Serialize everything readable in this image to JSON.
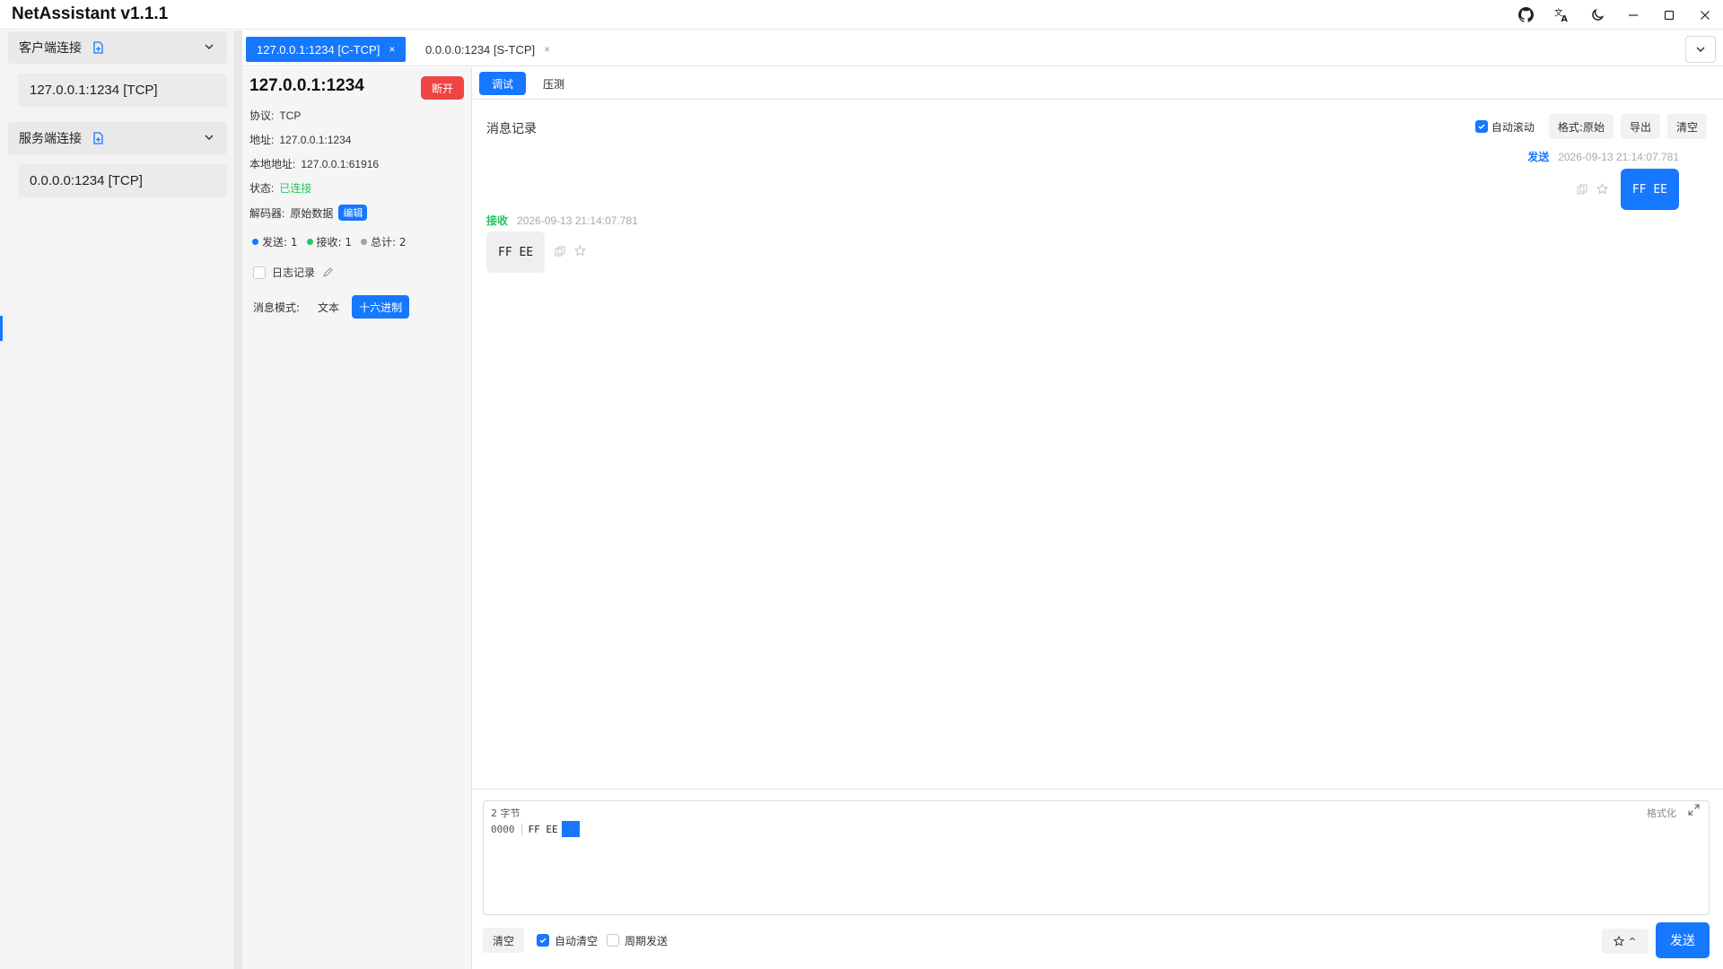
{
  "app": {
    "title": "NetAssistant v1.1.1"
  },
  "title_controls": [
    "github-icon",
    "translate-icon",
    "moon-icon",
    "minimize-icon",
    "maximize-icon",
    "close-icon"
  ],
  "sidebar": {
    "client_group": {
      "label": "客户端连接",
      "items": [
        "127.0.0.1:1234 [TCP]"
      ]
    },
    "server_group": {
      "label": "服务端连接",
      "items": [
        "0.0.0.0:1234 [TCP]"
      ]
    }
  },
  "tabs": [
    {
      "label": "127.0.0.1:1234 [C-TCP]",
      "close": "×",
      "active": true
    },
    {
      "label": "0.0.0.0:1234 [S-TCP]",
      "close": "×",
      "active": false
    }
  ],
  "info": {
    "title": "127.0.0.1:1234",
    "disconnect_label": "断开",
    "protocol_label": "协议:",
    "protocol_value": "TCP",
    "address_label": "地址:",
    "address_value": "127.0.0.1:1234",
    "local_label": "本地地址:",
    "local_value": "127.0.0.1:61916",
    "status_label": "状态:",
    "status_value": "已连接",
    "decoder_label": "解码器:",
    "decoder_value": "原始数据",
    "edit_label": "编辑",
    "stats": {
      "sent": "发送: 1",
      "received": "接收: 1",
      "total": "总计: 2"
    },
    "log_label": "日志记录",
    "mode_label": "消息模式:",
    "mode_text": "文本",
    "mode_hex": "十六进制"
  },
  "main_tabs": {
    "debug": "调试",
    "stress": "压测"
  },
  "log": {
    "title": "消息记录",
    "auto_scroll": "自动滚动",
    "format_btn": "格式:原始",
    "export_btn": "导出",
    "clear_btn": "清空",
    "messages": [
      {
        "direction": "发送",
        "time": "2026-09-13 21:14:07.781",
        "content": "FF EE"
      },
      {
        "direction": "接收",
        "time": "2026-09-13 21:14:07.781",
        "content": "FF EE"
      }
    ]
  },
  "editor": {
    "byte_count": "2 字节",
    "format_link": "格式化",
    "offset": "0000",
    "bytes": "FF EE"
  },
  "bottom": {
    "clear": "清空",
    "auto_clear": "自动清空",
    "periodic_send": "周期发送",
    "favorites_caret": "^",
    "send": "发送"
  },
  "colors": {
    "accent": "#1677ff",
    "danger": "#ef4444",
    "success": "#22c55e"
  }
}
